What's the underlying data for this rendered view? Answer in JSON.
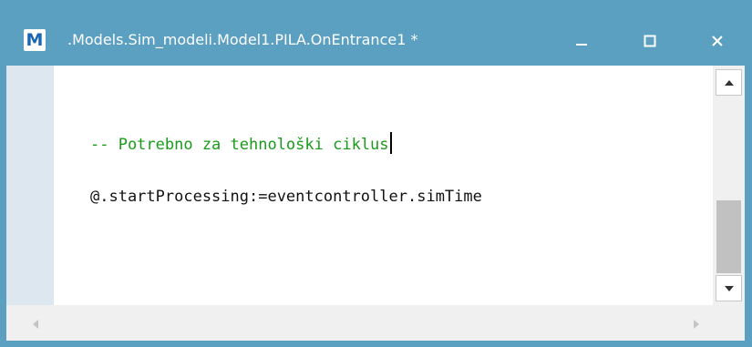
{
  "window": {
    "title": ".Models.Sim_modeli.Model1.PILA.OnEntrance1 *",
    "app_icon_letter": "M",
    "icons": {
      "app": "app-logo-icon",
      "minimize": "minimize-icon",
      "maximize": "maximize-icon",
      "close": "close-icon"
    },
    "colors": {
      "titlebar": "#5b9fc1",
      "app_icon_letter": "#1a66b3",
      "comment": "#1a9a1a",
      "code": "#111111",
      "gutter": "#dde7ef"
    }
  },
  "editor": {
    "lines": [
      {
        "text": "-- Potrebno za tehnološki ciklus",
        "kind": "comment"
      },
      {
        "text": "@.startProcessing:=eventcontroller.simTime",
        "kind": "code"
      }
    ]
  },
  "scrollbars": {
    "vertical": {
      "icons": [
        "scroll-up-icon",
        "scroll-down-icon"
      ],
      "thumb_position": 0.7
    },
    "horizontal": {
      "icons": [
        "scroll-left-icon",
        "scroll-right-icon"
      ]
    }
  }
}
